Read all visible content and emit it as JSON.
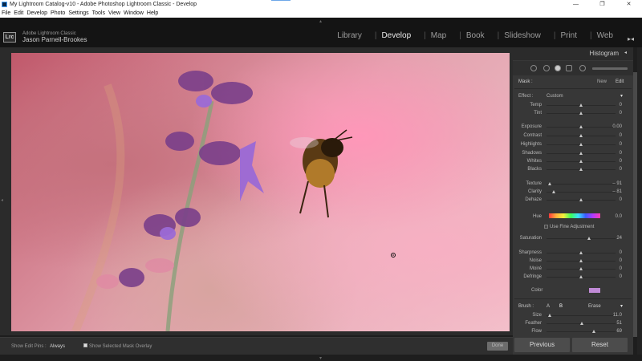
{
  "window": {
    "title": "My Lightroom Catalog-v10 - Adobe Photoshop Lightroom Classic - Develop",
    "controls": [
      "—",
      "❐",
      "✕"
    ]
  },
  "menu": [
    "File",
    "Edit",
    "Develop",
    "Photo",
    "Settings",
    "Tools",
    "View",
    "Window",
    "Help"
  ],
  "identity": {
    "logo": "Lrc",
    "app": "Adobe Lightroom Classic",
    "user": "Jason Parnell-Brookes"
  },
  "modules": [
    "Library",
    "Develop",
    "Map",
    "Book",
    "Slideshow",
    "Print",
    "Web"
  ],
  "active_module": "Develop",
  "panel": {
    "title": "Histogram",
    "mask_label": "Mask :",
    "new_label": "New",
    "edit_label": "Edit",
    "effect_label": "Effect :",
    "effect_value": "Custom"
  },
  "sliders": [
    {
      "label": "Temp",
      "value": "0",
      "pos": 0.5
    },
    {
      "label": "Tint",
      "value": "0",
      "pos": 0.5
    },
    {
      "label": "Exposure",
      "value": "0.00",
      "pos": 0.5
    },
    {
      "label": "Contrast",
      "value": "0",
      "pos": 0.5
    },
    {
      "label": "Highlights",
      "value": "0",
      "pos": 0.5
    },
    {
      "label": "Shadows",
      "value": "0",
      "pos": 0.5
    },
    {
      "label": "Whites",
      "value": "0",
      "pos": 0.5
    },
    {
      "label": "Blacks",
      "value": "0",
      "pos": 0.5
    },
    {
      "label": "Texture",
      "value": "– 91",
      "pos": 0.05
    },
    {
      "label": "Clarity",
      "value": "– 81",
      "pos": 0.1
    },
    {
      "label": "Dehaze",
      "value": "0",
      "pos": 0.5
    },
    {
      "label": "Hue",
      "value": "0.0",
      "pos": 0.5
    },
    {
      "label": "Saturation",
      "value": "24",
      "pos": 0.62
    },
    {
      "label": "Sharpness",
      "value": "0",
      "pos": 0.5
    },
    {
      "label": "Noise",
      "value": "0",
      "pos": 0.5
    },
    {
      "label": "Moiré",
      "value": "0",
      "pos": 0.5
    },
    {
      "label": "Defringe",
      "value": "0",
      "pos": 0.5
    }
  ],
  "fine_adjust_label": "Use Fine Adjustment",
  "color_label": "Color",
  "brush": {
    "label": "Brush :",
    "a": "A",
    "b": "B",
    "erase": "Erase",
    "size_label": "Size",
    "size_value": "11.0",
    "size_pos": 0.05,
    "feather_label": "Feather",
    "feather_value": "51",
    "feather_pos": 0.51,
    "flow_label": "Flow",
    "flow_value": "69",
    "flow_pos": 0.69
  },
  "toolbar": {
    "show_pins_label": "Show Edit Pins :",
    "show_pins_value": "Always",
    "overlay_label": "Show Selected Mask Overlay",
    "done_label": "Done"
  },
  "buttons": {
    "previous": "Previous",
    "reset": "Reset"
  },
  "colors": {
    "accent_swatch": "#c08ad6",
    "panel_bg": "#373737"
  }
}
